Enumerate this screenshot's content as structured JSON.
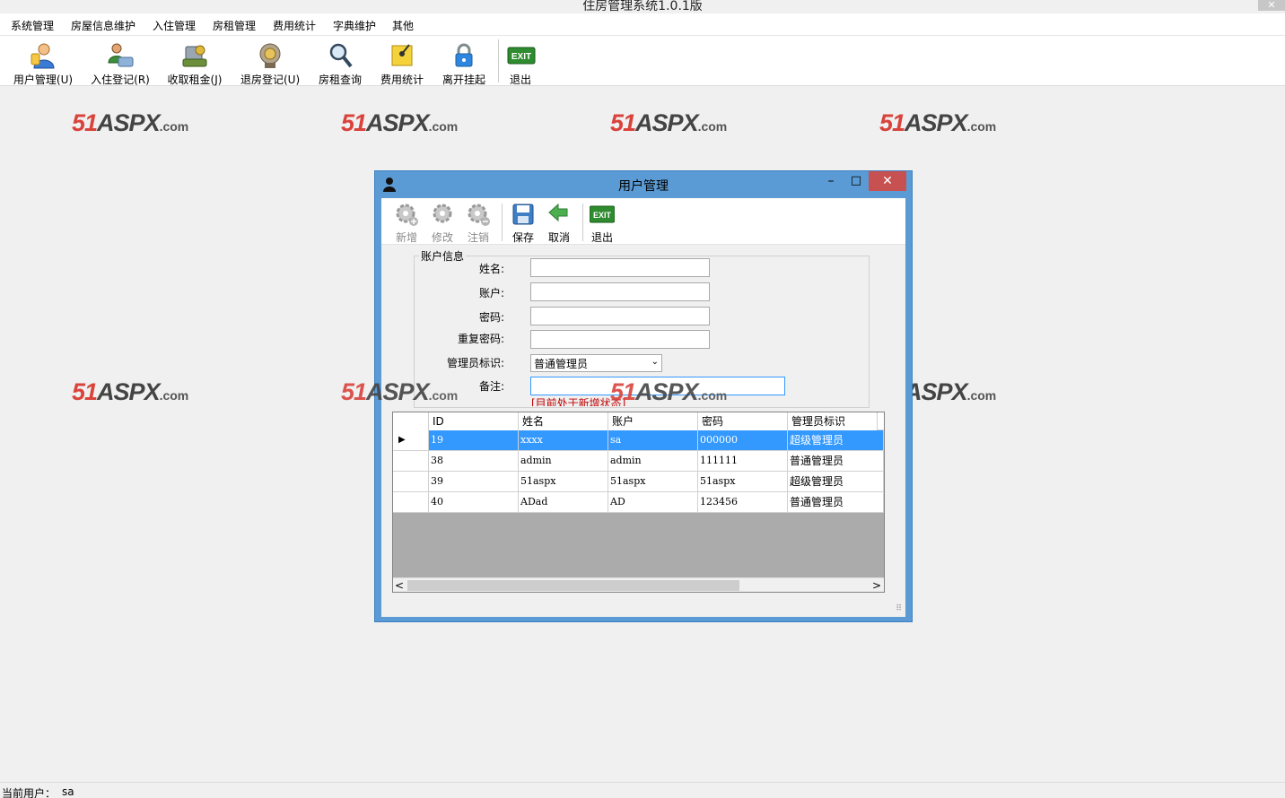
{
  "app": {
    "title": "住房管理系统1.0.1版",
    "close_glyph": "✕"
  },
  "menu": [
    "系统管理",
    "房屋信息维护",
    "入住管理",
    "房租管理",
    "费用统计",
    "字典维护",
    "其他"
  ],
  "toolbar": [
    {
      "label": "用户管理(U)",
      "icon": "user-manage-icon"
    },
    {
      "label": "入住登记(R)",
      "icon": "checkin-icon"
    },
    {
      "label": "收取租金(J)",
      "icon": "rent-money-icon"
    },
    {
      "label": "退房登记(U)",
      "icon": "checkout-icon"
    },
    {
      "label": "房租查询",
      "icon": "magnifier-icon"
    },
    {
      "label": "费用统计",
      "icon": "stats-note-icon"
    },
    {
      "label": "离开挂起",
      "icon": "lock-icon"
    },
    {
      "label": "退出",
      "icon": "exit-icon"
    }
  ],
  "watermark": {
    "part1": "51",
    "part2": "ASPX",
    "part3": ".com"
  },
  "dialog": {
    "title": "用户管理",
    "min_glyph": "–",
    "max_glyph": "□",
    "close_glyph": "✕",
    "toolbar": [
      {
        "label": "新增",
        "enabled": false
      },
      {
        "label": "修改",
        "enabled": false
      },
      {
        "label": "注销",
        "enabled": false
      },
      {
        "label": "保存",
        "enabled": true
      },
      {
        "label": "取消",
        "enabled": true
      },
      {
        "label": "退出",
        "enabled": true
      }
    ],
    "exit_badge": "EXIT",
    "group_title": "账户信息",
    "fields": {
      "name_label": "姓名:",
      "account_label": "账户:",
      "password_label": "密码:",
      "repeat_label": "重复密码:",
      "admin_label": "管理员标识:",
      "remark_label": "备注:",
      "name_value": "",
      "account_value": "",
      "password_value": "",
      "repeat_value": "",
      "admin_value": "普通管理员",
      "remark_value": ""
    },
    "notice": "[目前处于新增状态]",
    "grid": {
      "columns": [
        "ID",
        "姓名",
        "账户",
        "密码",
        "管理员标识"
      ],
      "rows": [
        [
          "19",
          "xxxx",
          "sa",
          "000000",
          "超级管理员"
        ],
        [
          "38",
          "admin",
          "admin",
          "111111",
          "普通管理员"
        ],
        [
          "39",
          "51aspx",
          "51aspx",
          "51aspx",
          "超级管理员"
        ],
        [
          "40",
          "ADad",
          "AD",
          "123456",
          "普通管理员"
        ]
      ],
      "selected_row": 0,
      "row_marker": "▶",
      "scroll_left": "<",
      "scroll_right": ">"
    }
  },
  "status": {
    "label": "当前用户：",
    "user": "sa"
  },
  "colors": {
    "selection": "#3399ff",
    "dialog_frame": "#5b9bd5",
    "close_button": "#c75050",
    "notice": "#c00000"
  }
}
